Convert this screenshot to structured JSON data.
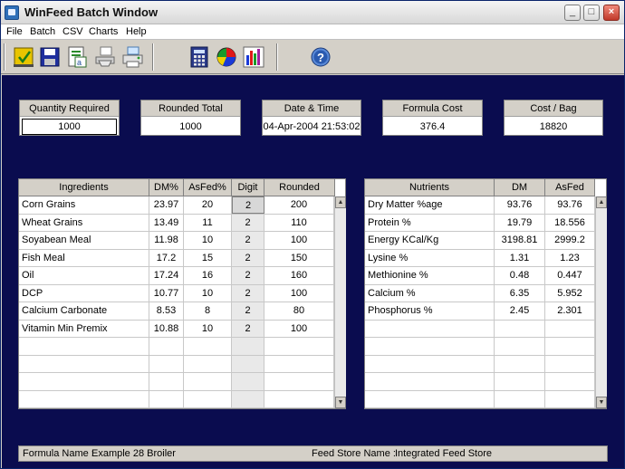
{
  "window": {
    "title": "WinFeed Batch Window"
  },
  "menu": [
    "File",
    "Batch",
    "CSV",
    "Charts",
    "Help"
  ],
  "toolbar": {
    "buttons": [
      "save-check",
      "save-disk",
      "export-excel",
      "print-preview",
      "print",
      "calculator",
      "pie-chart",
      "bar-chart",
      "help"
    ]
  },
  "summary": {
    "quantity_label": "Quantity Required",
    "quantity_value": "1000",
    "rounded_label": "Rounded Total",
    "rounded_value": "1000",
    "datetime_label": "Date & Time",
    "datetime_value": "04-Apr-2004 21:53:02",
    "cost_label": "Formula Cost",
    "cost_value": "376.4",
    "bag_label": "Cost / Bag",
    "bag_value": "18820"
  },
  "ingredients": {
    "headers": [
      "Ingredients",
      "DM%",
      "AsFed%",
      "Digit",
      "Rounded"
    ],
    "rows": [
      [
        "Corn Grains",
        "23.97",
        "20",
        "2",
        "200"
      ],
      [
        "Wheat Grains",
        "13.49",
        "11",
        "2",
        "110"
      ],
      [
        "Soyabean Meal",
        "11.98",
        "10",
        "2",
        "100"
      ],
      [
        "Fish Meal",
        "17.2",
        "15",
        "2",
        "150"
      ],
      [
        "Oil",
        "17.24",
        "16",
        "2",
        "160"
      ],
      [
        "DCP",
        "10.77",
        "10",
        "2",
        "100"
      ],
      [
        "Calcium Carbonate",
        "8.53",
        "8",
        "2",
        "80"
      ],
      [
        "Vitamin Min Premix",
        "10.88",
        "10",
        "2",
        "100"
      ]
    ],
    "empty_rows": 4
  },
  "nutrients": {
    "headers": [
      "Nutrients",
      "DM",
      "AsFed"
    ],
    "rows": [
      [
        "Dry Matter %age",
        "93.76",
        "93.76"
      ],
      [
        "Protein %",
        "19.79",
        "18.556"
      ],
      [
        "Energy KCal/Kg",
        "3198.81",
        "2999.2"
      ],
      [
        "Lysine %",
        "1.31",
        "1.23"
      ],
      [
        "Methionine %",
        "0.48",
        "0.447"
      ],
      [
        "Calcium %",
        "6.35",
        "5.952"
      ],
      [
        "Phosphorus %",
        "2.45",
        "2.301"
      ]
    ],
    "empty_rows": 5
  },
  "status": {
    "formula_label": "Formula Name :",
    "formula_value": "Example 28 Broiler",
    "store_label": "Feed Store Name :",
    "store_value": "Integrated Feed Store"
  },
  "colors": {
    "workspace": "#0a0c4f",
    "chrome": "#d4d0c8"
  }
}
